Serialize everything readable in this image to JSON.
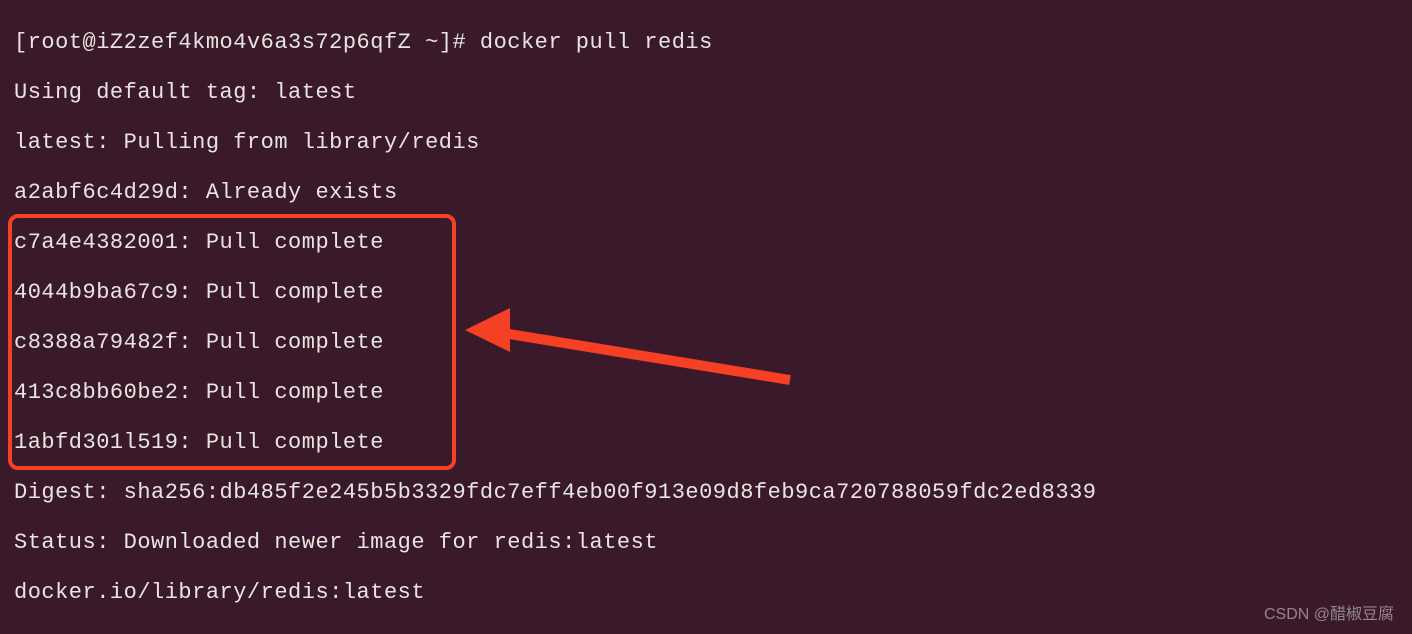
{
  "terminal": {
    "prompt": "[root@iZ2zef4kmo4v6a3s72p6qfZ ~]# ",
    "command": "docker pull redis",
    "lines": [
      "Using default tag: latest",
      "latest: Pulling from library/redis",
      "a2abf6c4d29d: Already exists",
      "c7a4e4382001: Pull complete",
      "4044b9ba67c9: Pull complete",
      "c8388a79482f: Pull complete",
      "413c8bb60be2: Pull complete",
      "1abfd301l519: Pull complete",
      "Digest: sha256:db485f2e245b5b3329fdc7eff4eb00f913e09d8feb9ca720788059fdc2ed8339",
      "Status: Downloaded newer image for redis:latest",
      "docker.io/library/redis:latest"
    ]
  },
  "watermark": "CSDN @醋椒豆腐"
}
